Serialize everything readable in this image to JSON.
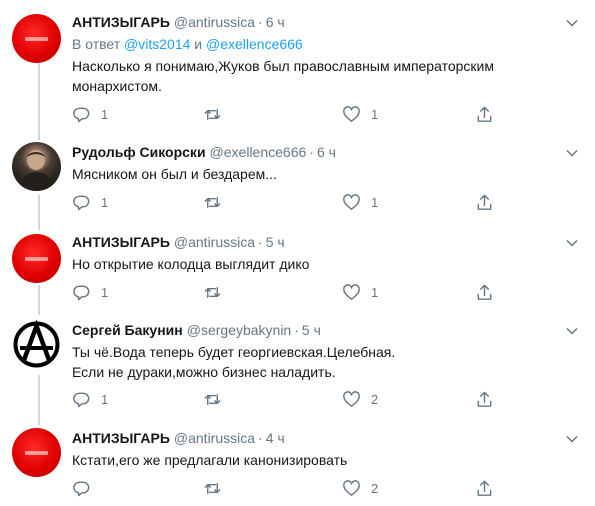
{
  "tweets": [
    {
      "avatar": "red-circle-avatar",
      "name": "АНТИЗЫГАРЬ",
      "handle": "@antirussica",
      "time": "6 ч",
      "reply_prefix": "В ответ",
      "reply_user1": "@vits2014",
      "reply_and": "и",
      "reply_user2": "@exellence666",
      "text": "Насколько я понимаю,Жуков был православным императорским монархистом.",
      "replies": "1",
      "retweets": "",
      "likes": "1"
    },
    {
      "avatar": "photo-avatar",
      "name": "Рудольф Сикорски",
      "handle": "@exellence666",
      "time": "6 ч",
      "text": "Мясником он был и бездарем...",
      "replies": "1",
      "retweets": "",
      "likes": "1"
    },
    {
      "avatar": "red-circle-avatar",
      "name": "АНТИЗЫГАРЬ",
      "handle": "@antirussica",
      "time": "5 ч",
      "text": "Но открытие колодца выглядит дико",
      "replies": "1",
      "retweets": "",
      "likes": "1"
    },
    {
      "avatar": "anarchy-symbol-avatar",
      "name": "Сергей Бакунин",
      "handle": "@sergeybakynin",
      "time": "5 ч",
      "text_line1": "Ты чё.Вода теперь будет георгиевская.Целебная.",
      "text_line2": "Если не дураки,можно бизнес наладить.",
      "replies": "1",
      "retweets": "",
      "likes": "2"
    },
    {
      "avatar": "red-circle-avatar",
      "name": "АНТИЗЫГАРЬ",
      "handle": "@antirussica",
      "time": "4 ч",
      "text": "Кстати,его же предлагали канонизировать",
      "replies": "",
      "retweets": "",
      "likes": "2"
    }
  ],
  "icons": {
    "reply": "reply-icon",
    "retweet": "retweet-icon",
    "like": "heart-icon",
    "share": "share-icon",
    "more": "chevron-down-icon"
  },
  "colors": {
    "link": "#1da1f2",
    "muted": "#657786",
    "thread_line": "#ccd6dd"
  }
}
